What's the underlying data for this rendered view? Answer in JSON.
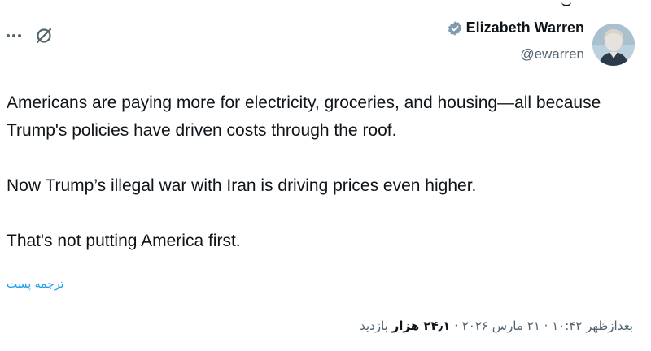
{
  "tweet": {
    "author": {
      "name": "Elizabeth Warren",
      "handle": "@ewarren",
      "verified": true,
      "verified_color": "#829aab"
    },
    "paragraphs": [
      "Americans are paying more for electricity, groceries, and housing—all because Trump's policies have driven costs through the roof.",
      "Now Trump’s illegal war with Iran is driving prices even higher.",
      "That's not putting America first."
    ],
    "translate_label": "ترجمه پست",
    "timestamp": "بعدازظهر ۱۰:۴۲ · ۲۱ مارس ۲۰۲۶",
    "separator": " · ",
    "views_count": "۲۴٫۱ هزار",
    "views_label": "بازدید",
    "icons": {
      "more": "more-horizontal-icon",
      "grok": "grok-icon",
      "verified": "verified-badge-icon"
    },
    "colors": {
      "text": "#0f1419",
      "secondary": "#536471",
      "link": "#1d9bf0"
    }
  }
}
